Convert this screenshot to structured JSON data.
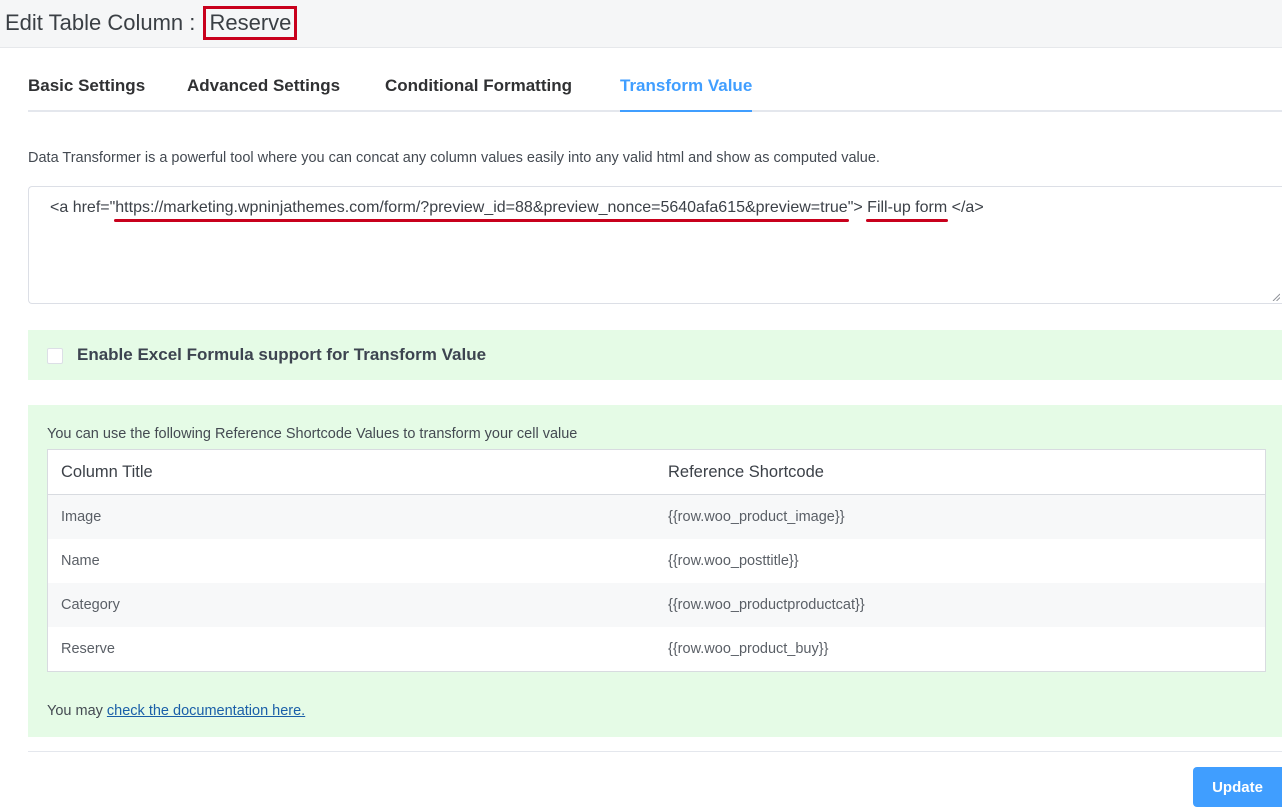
{
  "header": {
    "title_prefix": "Edit Table Column : ",
    "column_name": "Reserve"
  },
  "tabs": [
    {
      "label": "Basic Settings",
      "active": false
    },
    {
      "label": "Advanced Settings",
      "active": false
    },
    {
      "label": "Conditional Formatting",
      "active": false
    },
    {
      "label": "Transform Value",
      "active": true
    }
  ],
  "transform": {
    "description": "Data Transformer is a powerful tool where you can concat any column values easily into any valid html and show as computed value.",
    "code_part1": "<a href=\"",
    "code_url": "https://marketing.wpninjathemes.com/form/?preview_id=88&preview_nonce=5640afa615&preview=true",
    "code_part2": "\"> ",
    "code_link_text": "Fill-up form",
    "code_part3": " </a>"
  },
  "excel": {
    "label": "Enable Excel Formula support for Transform Value",
    "checked": false
  },
  "reference": {
    "intro": "You can use the following Reference Shortcode Values to transform your cell value",
    "headers": [
      "Column Title",
      "Reference Shortcode"
    ],
    "rows": [
      {
        "title": "Image",
        "shortcode": "{{row.woo_product_image}}"
      },
      {
        "title": "Name",
        "shortcode": "{{row.woo_posttitle}}"
      },
      {
        "title": "Category",
        "shortcode": "{{row.woo_productproductcat}}"
      },
      {
        "title": "Reserve",
        "shortcode": "{{row.woo_product_buy}}"
      }
    ],
    "doc_prefix": "You may ",
    "doc_link": "check the documentation here."
  },
  "footer": {
    "update_label": "Update"
  },
  "colors": {
    "accent": "#409eff",
    "annotation_red": "#c8001c",
    "panel_green": "#e5fbe6"
  }
}
